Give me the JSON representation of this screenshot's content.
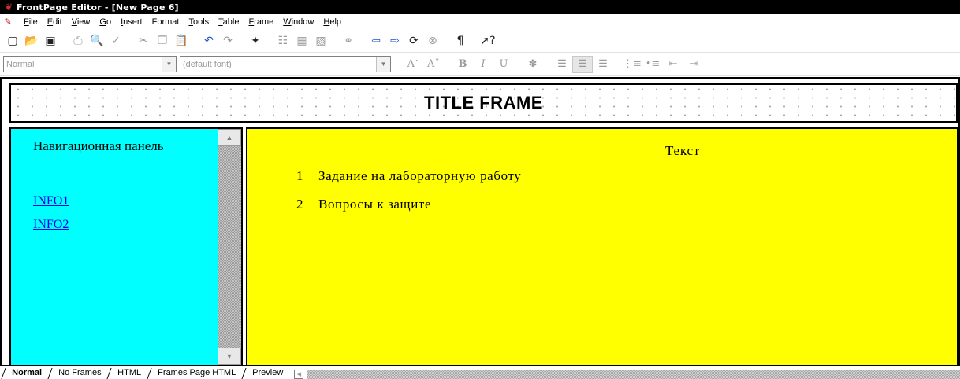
{
  "window": {
    "title": "FrontPage Editor - [New Page 6]",
    "app_icon": "frontpage-app-icon"
  },
  "menu": {
    "doc_icon": "document-icon",
    "items": [
      {
        "mnemonic": "F",
        "rest": "ile"
      },
      {
        "mnemonic": "E",
        "rest": "dit"
      },
      {
        "mnemonic": "V",
        "rest": "iew"
      },
      {
        "mnemonic": "G",
        "rest": "o"
      },
      {
        "mnemonic": "I",
        "rest": "nsert"
      },
      {
        "mnemonic": "F",
        "rest": "ormat",
        "mnemonic_index": 1
      },
      {
        "mnemonic": "T",
        "rest": "ools"
      },
      {
        "mnemonic": "T",
        "rest": "able"
      },
      {
        "mnemonic": "F",
        "rest": "rame"
      },
      {
        "mnemonic": "W",
        "rest": "indow"
      },
      {
        "mnemonic": "H",
        "rest": "elp"
      }
    ]
  },
  "standard_toolbar": {
    "buttons": [
      "new-page",
      "open",
      "save",
      "print",
      "print-preview",
      "spelling",
      "cut",
      "copy",
      "paste",
      "undo",
      "redo",
      "web-bot",
      "insert-table",
      "insert-image",
      "insert-hyperlink",
      "back",
      "forward",
      "refresh",
      "stop",
      "show-formatting",
      "help"
    ]
  },
  "format_toolbar": {
    "style_value": "Normal",
    "font_value": "(default font)",
    "buttons": [
      "increase-font",
      "decrease-font",
      "bold",
      "italic",
      "underline",
      "text-color",
      "align-left",
      "align-center",
      "align-right",
      "numbered-list",
      "bulleted-list",
      "decrease-indent",
      "increase-indent"
    ]
  },
  "frames": {
    "title_frame": {
      "text": "TITLE FRAME"
    },
    "nav_frame": {
      "heading": "Навигационная панель",
      "links": [
        "INFO1",
        "INFO2"
      ],
      "background": "#00ffff"
    },
    "content_frame": {
      "heading": "Текст",
      "items": [
        {
          "number": "1",
          "text": "Задание на лабораторную работу"
        },
        {
          "number": "2",
          "text": "Вопросы к защите"
        }
      ],
      "background": "#ffff00"
    }
  },
  "tabs": {
    "items": [
      "Normal",
      "No Frames",
      "HTML",
      "Frames Page HTML",
      "Preview"
    ],
    "active": "Normal"
  },
  "colors": {
    "title_bar": "#000000",
    "nav_bg": "#00ffff",
    "content_bg": "#ffff00",
    "link": "#0000ee"
  }
}
